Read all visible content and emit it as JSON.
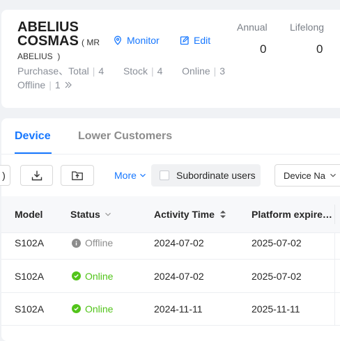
{
  "customer": {
    "name_line1": "ABELIUS",
    "name_line2": "COSMAS",
    "name_paren_open": "( MR",
    "name_line3": "ABELIUS  )"
  },
  "actions": {
    "monitor_label": "Monitor",
    "edit_label": "Edit"
  },
  "stats": {
    "purchase_label": "Purchase、Total",
    "purchase_value": "4",
    "stock_label": "Stock",
    "stock_value": "4",
    "online_label": "Online",
    "online_value": "3",
    "offline_label": "Offline",
    "offline_value": "1"
  },
  "cards": {
    "annual_label": "Annual",
    "annual_value": "0",
    "lifelong_label": "Lifelong",
    "lifelong_value": "0"
  },
  "tabs": [
    {
      "label": "Device",
      "active": true
    },
    {
      "label": "Lower Customers",
      "active": false
    }
  ],
  "toolbar": {
    "more_label": "More",
    "subordinate_label": "Subordinate users",
    "device_select_value": "Device Na"
  },
  "table": {
    "headers": {
      "model": "Model",
      "status": "Status",
      "activity_time": "Activity Time",
      "platform_expire": "Platform expire…"
    },
    "rows": [
      {
        "model": "S102A",
        "status": "Offline",
        "activity_time": "2024-07-02",
        "platform_expire": "2025-07-02"
      },
      {
        "model": "S102A",
        "status": "Online",
        "activity_time": "2024-07-02",
        "platform_expire": "2025-07-02"
      },
      {
        "model": "S102A",
        "status": "Online",
        "activity_time": "2024-11-11",
        "platform_expire": "2025-11-11"
      }
    ]
  },
  "colors": {
    "accent": "#1677ff",
    "online": "#52c41a",
    "offline": "#8c8c8c"
  },
  "icons": [
    "location-pin-icon",
    "edit-icon",
    "double-chevron-right-icon",
    "download-icon",
    "upload-folder-icon",
    "chevron-down-icon",
    "sort-icon",
    "filter-chevron-icon",
    "check-circle-icon",
    "info-circle-icon"
  ]
}
